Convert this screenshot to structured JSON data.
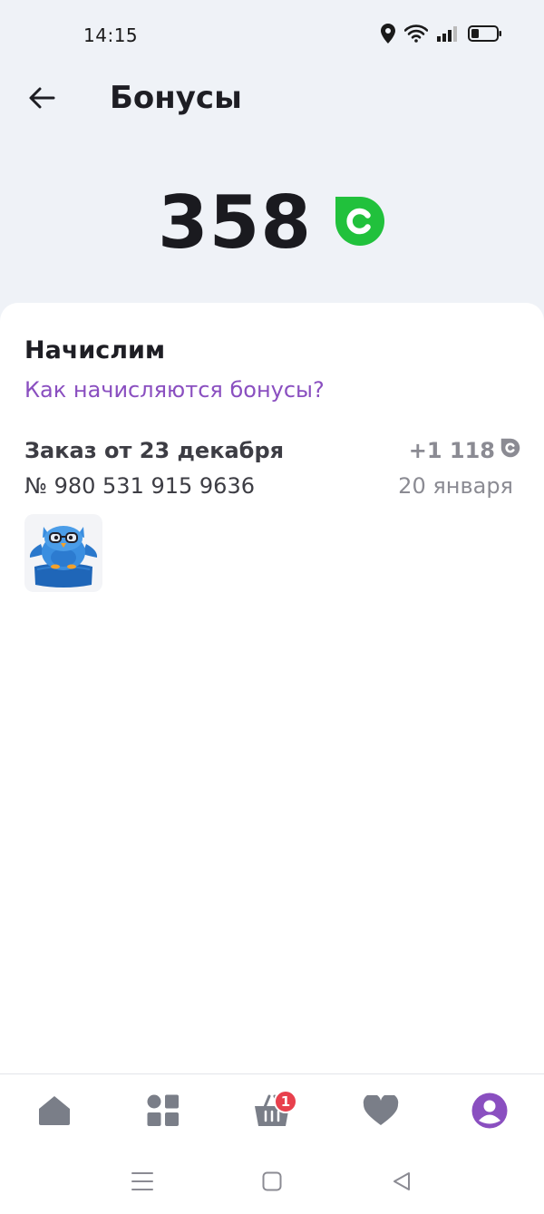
{
  "status_bar": {
    "time": "14:15",
    "icons": [
      "location-icon",
      "wifi-icon",
      "signal-icon",
      "battery-icon"
    ]
  },
  "header": {
    "back_icon": "arrow-left-icon",
    "title": "Бонусы"
  },
  "balance": {
    "value": "358",
    "icon": "bonus-coin-icon",
    "accent_color": "#21c13c"
  },
  "accruals": {
    "title": "Начислим",
    "howto_link": "Как начисляются бонусы?",
    "link_color": "#8a4fc0",
    "orders": [
      {
        "title": "Заказ от 23 декабря",
        "number": "№ 980 531 915 9636",
        "amount": "+1 118",
        "date": "20 января",
        "thumbnail": "owl-pillow-product"
      }
    ]
  },
  "bottom_nav": {
    "items": [
      {
        "icon": "home-icon"
      },
      {
        "icon": "catalog-icon"
      },
      {
        "icon": "cart-icon",
        "badge": "1"
      },
      {
        "icon": "heart-icon"
      },
      {
        "icon": "profile-icon",
        "active": true
      }
    ],
    "active_color": "#8a4fc0",
    "inactive_color": "#7a7e88",
    "badge_color": "#e8404d"
  },
  "system_nav": {
    "icons": [
      "menu-icon",
      "home-square-icon",
      "back-triangle-icon"
    ]
  }
}
